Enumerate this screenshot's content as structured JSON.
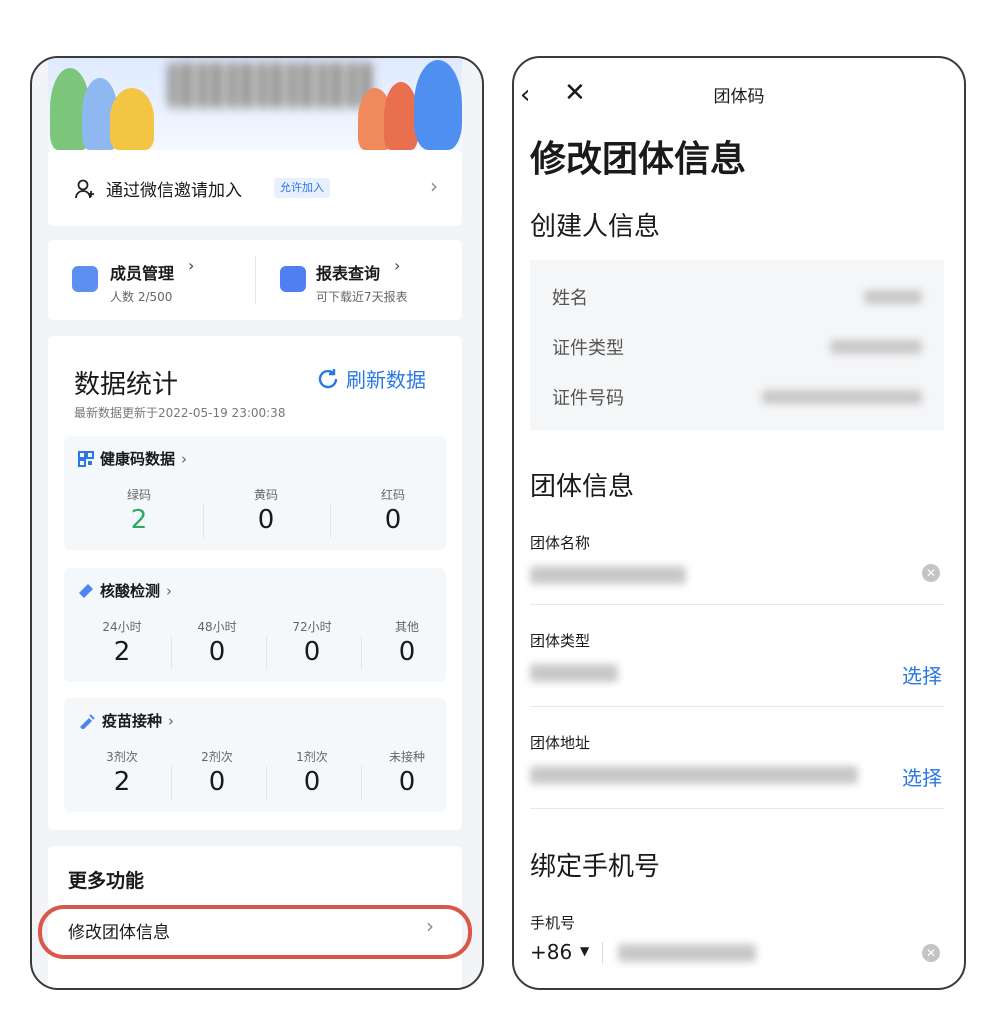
{
  "left": {
    "invite": {
      "text": "通过微信邀请加入",
      "tag": "允许加入"
    },
    "member": {
      "title": "成员管理",
      "sub": "人数 2/500"
    },
    "report": {
      "title": "报表查询",
      "sub": "可下载近7天报表"
    },
    "stats": {
      "title": "数据统计",
      "refresh": "刷新数据",
      "updated": "最新数据更新于2022-05-19 23:00:38",
      "health": {
        "title": "健康码数据",
        "cols": [
          {
            "label": "绿码",
            "value": "2"
          },
          {
            "label": "黄码",
            "value": "0"
          },
          {
            "label": "红码",
            "value": "0"
          }
        ]
      },
      "nat": {
        "title": "核酸检测",
        "cols": [
          {
            "label": "24小时",
            "value": "2"
          },
          {
            "label": "48小时",
            "value": "0"
          },
          {
            "label": "72小时",
            "value": "0"
          },
          {
            "label": "其他",
            "value": "0"
          }
        ]
      },
      "vaccine": {
        "title": "疫苗接种",
        "cols": [
          {
            "label": "3剂次",
            "value": "2"
          },
          {
            "label": "2剂次",
            "value": "0"
          },
          {
            "label": "1剂次",
            "value": "0"
          },
          {
            "label": "未接种",
            "value": "0"
          }
        ]
      }
    },
    "more": {
      "title": "更多功能",
      "edit": "修改团体信息"
    }
  },
  "right": {
    "nav_title": "团体码",
    "page_title": "修改团体信息",
    "creator": {
      "title": "创建人信息",
      "name_label": "姓名",
      "idtype_label": "证件类型",
      "idno_label": "证件号码"
    },
    "group": {
      "title": "团体信息",
      "name_label": "团体名称",
      "type_label": "团体类型",
      "address_label": "团体地址",
      "select_label": "选择"
    },
    "phone": {
      "title": "绑定手机号",
      "label": "手机号",
      "country_code": "+86"
    }
  },
  "colors": {
    "accent": "#2a78e4",
    "green": "#2faa63",
    "highlight": "#d9584a"
  }
}
